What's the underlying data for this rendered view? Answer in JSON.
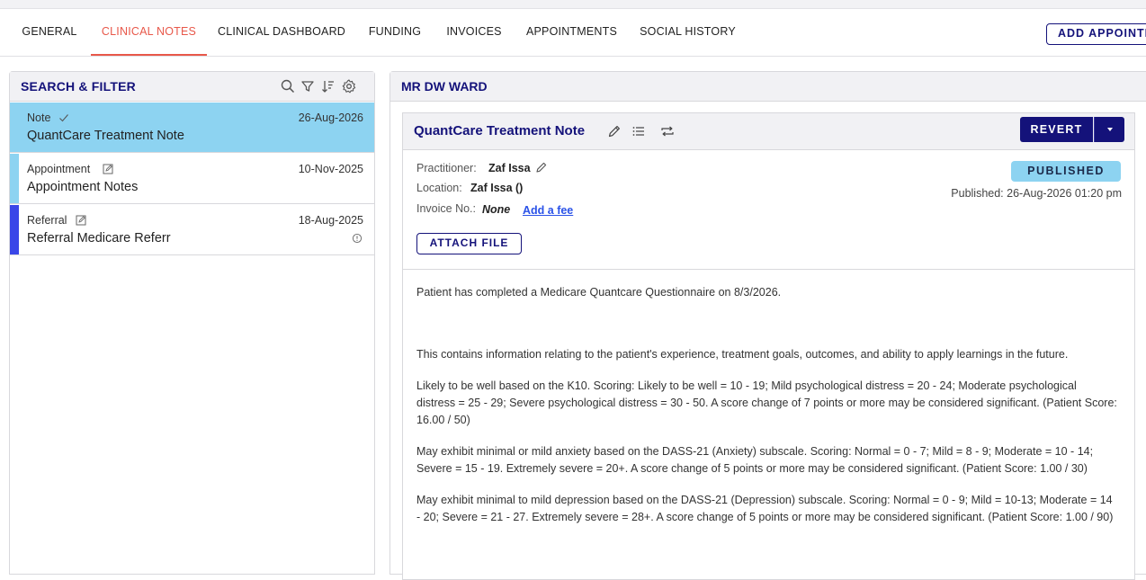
{
  "tabs": [
    {
      "label": "GENERAL",
      "active": false
    },
    {
      "label": "CLINICAL NOTES",
      "active": true
    },
    {
      "label": "CLINICAL DASHBOARD",
      "active": false
    },
    {
      "label": "FUNDING",
      "active": false
    },
    {
      "label": "INVOICES",
      "active": false
    },
    {
      "label": "APPOINTMENTS",
      "active": false
    },
    {
      "label": "SOCIAL HISTORY",
      "active": false
    }
  ],
  "add_appointment_label": "ADD APPOINTMENT",
  "left_panel": {
    "title": "SEARCH & FILTER",
    "icons": [
      "search-icon",
      "filter-icon",
      "sort-icon",
      "settings-icon"
    ],
    "items": [
      {
        "kind": "Note",
        "kind_icon": "check-icon",
        "date": "26-Aug-2026",
        "title": "QuantCare Treatment Note",
        "selected": true,
        "bar_color": "#8dd3f1"
      },
      {
        "kind": "Appointment",
        "kind_icon": "edit-icon",
        "date": "10-Nov-2025",
        "title": "Appointment Notes",
        "selected": false,
        "bar_color": "#8dd3f1"
      },
      {
        "kind": "Referral",
        "kind_icon": "edit-icon",
        "date": "18-Aug-2025",
        "title": "Referral Medicare Referr",
        "selected": false,
        "bar_color": "#3a47e8"
      }
    ]
  },
  "patient": {
    "name": "MR DW WARD"
  },
  "note": {
    "title": "QuantCare Treatment Note",
    "revert_label": "REVERT",
    "practitioner_label": "Practitioner:",
    "practitioner": "Zaf Issa",
    "location_label": "Location:",
    "location": "Zaf Issa ()",
    "invoice_label": "Invoice No.:",
    "invoice": "None",
    "add_fee_label": "Add a fee",
    "attach_label": "ATTACH FILE",
    "status": "PUBLISHED",
    "published_date": "Published: 26-Aug-2026 01:20 pm",
    "paragraphs": [
      "Patient has completed a Medicare Quantcare Questionnaire on 8/3/2026.",
      "This contains information relating to the patient's experience, treatment goals, outcomes, and ability to apply learnings in the future.",
      "Likely to be well based on the K10. Scoring: Likely to be well = 10 - 19; Mild psychological distress = 20 - 24; Moderate psychological distress = 25 - 29; Severe psychological distress = 30 - 50. A score change of 7 points or more may be considered significant. (Patient Score: 16.00 / 50)",
      "May exhibit minimal or mild anxiety based on the DASS-21 (Anxiety) subscale. Scoring: Normal = 0 - 7; Mild = 8 - 9; Moderate = 10 - 14; Severe = 15 - 19. Extremely severe = 20+. A score change of 5 points or more may be considered significant. (Patient Score: 1.00 / 30)",
      "May exhibit minimal to mild depression based on the DASS-21 (Depression) subscale. Scoring: Normal = 0 - 9; Mild = 10-13; Moderate = 14 - 20; Severe = 21 - 27. Extremely severe = 28+. A score change of 5 points or more may be considered significant. (Patient Score: 1.00 / 90)"
    ]
  }
}
